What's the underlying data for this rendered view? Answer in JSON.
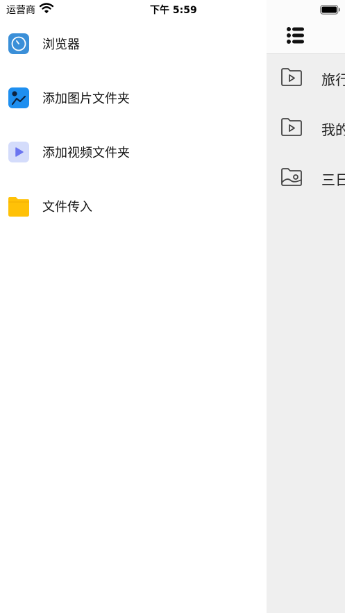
{
  "status_bar": {
    "carrier": "运营商",
    "time": "下午 5:59"
  },
  "drawer": {
    "items": [
      {
        "label": "浏览器",
        "icon": "browser-compass-icon"
      },
      {
        "label": "添加图片文件夹",
        "icon": "add-photo-folder-icon"
      },
      {
        "label": "添加视频文件夹",
        "icon": "add-video-folder-icon"
      },
      {
        "label": "文件传入",
        "icon": "file-import-folder-icon"
      }
    ]
  },
  "panel": {
    "menu_icon": "list-menu-icon",
    "folders": [
      {
        "label": "旅行",
        "icon": "video-folder-icon"
      },
      {
        "label": "我的",
        "icon": "video-folder-icon"
      },
      {
        "label": "三日",
        "icon": "photo-folder-icon"
      }
    ]
  },
  "colors": {
    "panel_background": "#efefef",
    "browser_icon": "#3a8fd8",
    "photo_icon": "#1e8ff0",
    "video_icon_bg": "#d4dcfb",
    "video_icon_fg": "#6a74f0",
    "folder_yellow": "#ffc107"
  }
}
